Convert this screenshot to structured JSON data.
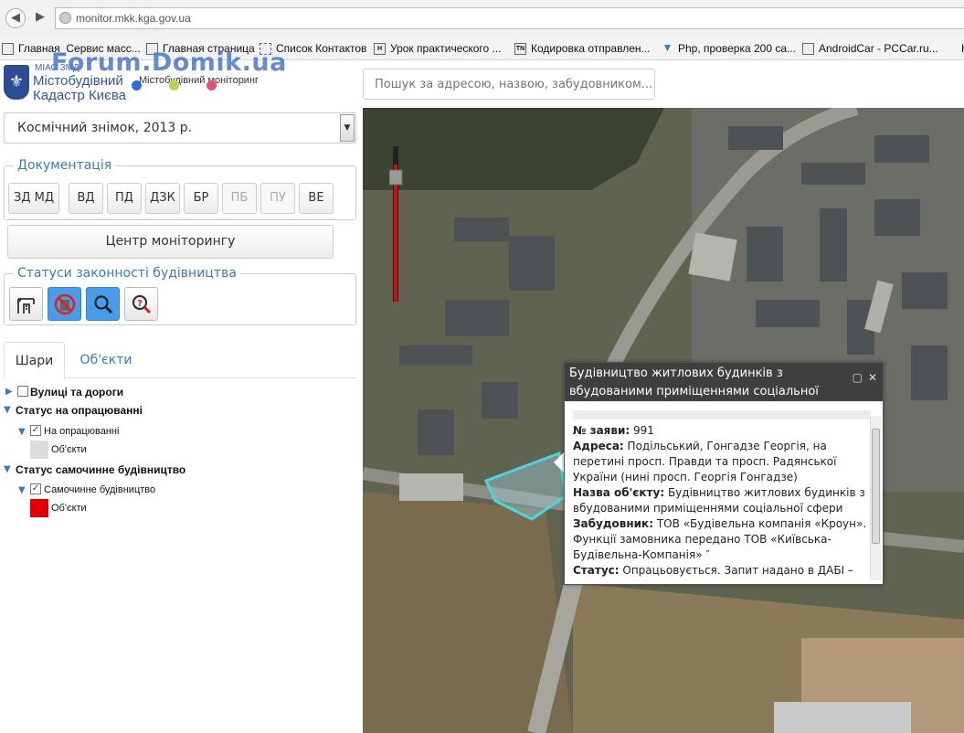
{
  "browser": {
    "url": "monitor.mkk.kga.gov.ua",
    "bookmarks": [
      "Главная_Сервис масс...",
      "Главная страница",
      "Список Контактов",
      "Урок практического ...",
      "Кодировка отправлен...",
      "Php, проверка 200 са...",
      "AndroidCar - PCCar.ru...",
      "H"
    ]
  },
  "header": {
    "logo_small": "МІАС ЗМД",
    "logo_line1": "Містобудівний",
    "logo_line2": "Кадастр Києва",
    "logo_sub": "Містобудівний моніторинг",
    "watermark": "Forum.Domik.ua",
    "search_placeholder": "Пошук за адресою, назвою, забудовником..."
  },
  "left": {
    "layer_select": "Космічний знімок, 2013 р.",
    "docs": {
      "legend": "Документація",
      "buttons": [
        {
          "label": "ЗД МД",
          "enabled": true
        },
        {
          "label": "ВД",
          "enabled": true
        },
        {
          "label": "ПД",
          "enabled": true
        },
        {
          "label": "ДЗК",
          "enabled": true
        },
        {
          "label": "БР",
          "enabled": true
        },
        {
          "label": "ПБ",
          "enabled": false
        },
        {
          "label": "ПУ",
          "enabled": false
        },
        {
          "label": "ВЕ",
          "enabled": true
        }
      ]
    },
    "center_button": "Центр моніторингу",
    "statuses": {
      "legend": "Статуси законності будівництва",
      "buttons": [
        "crane-icon",
        "no-building-icon",
        "magnifier-icon",
        "question-magnifier-icon"
      ]
    },
    "tabs": [
      "Шари",
      "Об'єкти"
    ],
    "tree": {
      "roads": "Вулиці та дороги",
      "status1": "Статус на опрацюванні",
      "status1_item": "На опрацюванні",
      "status1_obj": "Об'єкти",
      "status1_color": "#dcdcdc",
      "status2": "Статус самочинне будівництво",
      "status2_item": "Самочинне будівництво",
      "status2_obj": "Об'єкти",
      "status2_color": "#e00000"
    }
  },
  "popup": {
    "title": "Будівництво житлових будинків з вбудованими приміщеннями соціальної сфери",
    "fields": [
      {
        "label": "№ заяви:",
        "value": "991"
      },
      {
        "label": "Адреса:",
        "value": "Подільський, Гонгадзе Георгія, на перетині просп. Правди та просп. Радянської України (нині просп. Георгія Гонгадзе)"
      },
      {
        "label": "Назва об'єкту:",
        "value": "Будівництво житлових будинків з вбудованими приміщеннями соціальної сфери"
      },
      {
        "label": "Забудовник:",
        "value": "ТОВ «Будівельна компанія «Кроун». Функції замовника передано ТОВ «Київська-Будівельна-Компанія» ″"
      },
      {
        "label": "Статус:",
        "value": "Опрацьовується. Запит надано в ДАБІ – ДБ – РМ – ДЗР"
      }
    ]
  }
}
